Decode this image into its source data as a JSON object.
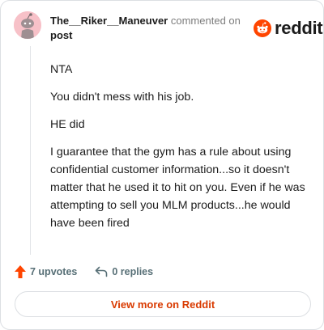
{
  "header": {
    "username": "The__Riker__Maneuver",
    "action_text": "commented on",
    "target": "post"
  },
  "logo": {
    "text": "reddit",
    "icon": "reddit-snoo-icon",
    "color": "#ff4500"
  },
  "comment": {
    "paragraphs": [
      "NTA",
      "You didn't mess with his job.",
      "HE did",
      "I guarantee that the gym has a rule about using confidential customer information...so it doesn't matter that he used it to hit on you. Even if he was attempting to sell you MLM products...he would have been fired"
    ]
  },
  "actions": {
    "upvotes_label": "7 upvotes",
    "upvote_icon": "upvote-arrow-icon",
    "replies_label": "0 replies",
    "reply_icon": "reply-arrow-icon"
  },
  "footer": {
    "view_more_label": "View more on Reddit",
    "accent": "#d93a00"
  }
}
